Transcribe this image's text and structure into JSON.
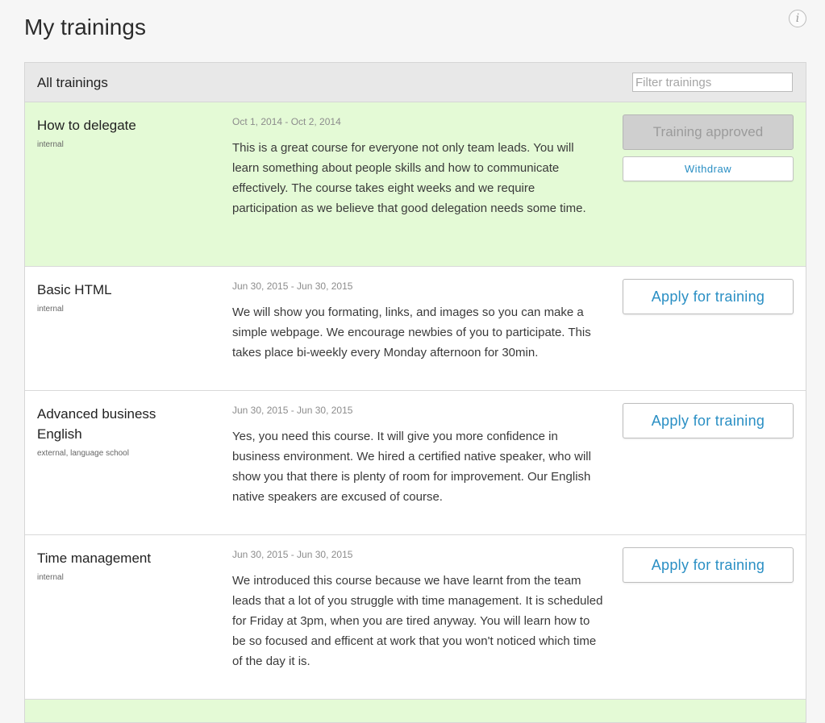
{
  "page": {
    "title": "My trainings",
    "info_icon_glyph": "i"
  },
  "panel": {
    "title": "All trainings",
    "filter_placeholder": "Filter trainings"
  },
  "trainings": [
    {
      "name": "How to delegate",
      "tags": "internal",
      "dates": "Oct 1, 2014 - Oct 2, 2014",
      "description": "This is a great course for everyone not only team leads. You will learn something about people skills and how to communicate effectively. The course takes eight weeks and we require participation as we believe that good delegation needs some time.",
      "status": "approved",
      "status_label": "Training approved",
      "withdraw_label": "Withdraw"
    },
    {
      "name": "Basic HTML",
      "tags": "internal",
      "dates": "Jun 30, 2015 - Jun 30, 2015",
      "description": "We will show you formating, links, and images so you can make a simple webpage. We encourage newbies of you to participate. This takes place bi-weekly every Monday afternoon for 30min.",
      "apply_label": "Apply for training"
    },
    {
      "name": "Advanced business English",
      "tags": "external, language school",
      "dates": "Jun 30, 2015 - Jun 30, 2015",
      "description": "Yes, you need this course. It will give you more confidence in business environment. We hired a certified native speaker, who will show you that there is plenty of room for improvement. Our English native speakers are excused of course.",
      "apply_label": "Apply for training"
    },
    {
      "name": "Time management",
      "tags": "internal",
      "dates": "Jun 30, 2015 - Jun 30, 2015",
      "description": "We introduced this course because we have learnt from the team leads that a lot of you struggle with time management. It is scheduled for Friday at 3pm, when you are tired anyway. You will learn how to be so focused and efficent at work that you won't noticed which time of the day it is.",
      "apply_label": "Apply for training"
    }
  ],
  "colors": {
    "approved_row_bg": "#e4fad6",
    "link_blue": "#2a8fc4"
  }
}
